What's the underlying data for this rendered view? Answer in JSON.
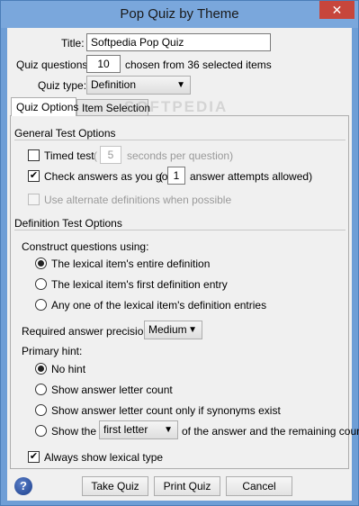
{
  "window": {
    "title": "Pop Quiz by Theme",
    "close_glyph": "✕"
  },
  "header": {
    "title_label": "Title:",
    "title_value": "Softpedia Pop Quiz",
    "questions_label": "Quiz questions:",
    "questions_value": "10",
    "questions_suffix": "chosen from 36 selected items",
    "type_label": "Quiz type:",
    "type_value": "Definition"
  },
  "tabs": [
    {
      "label": "Quiz Options",
      "active": true
    },
    {
      "label": "Item Selection",
      "active": false
    }
  ],
  "general": {
    "heading": "General Test Options",
    "timed_label": "Timed test",
    "timed_paren_open": "(",
    "timed_value": "5",
    "timed_suffix": "seconds per question)",
    "check_label": "Check answers as you go",
    "check_paren_open": "(",
    "check_value": "1",
    "check_suffix": "answer attempts allowed)",
    "alternate_label": "Use alternate definitions when possible",
    "check_mark": "✔"
  },
  "definition": {
    "heading": "Definition Test Options",
    "construct_label": "Construct questions using:",
    "construct_options": [
      "The lexical item's entire definition",
      "The lexical item's first definition entry",
      "Any one of the lexical item's definition entries"
    ],
    "precision_label": "Required answer precision:",
    "precision_value": "Medium",
    "hint_label": "Primary hint:",
    "hint_options": [
      "No hint",
      "Show answer letter count",
      "Show answer letter count only if synonyms exist"
    ],
    "show_prefix": "Show the",
    "show_select_value": "first letter",
    "show_suffix": "of the answer and the remaining count",
    "lexical_label": "Always show lexical type"
  },
  "footer": {
    "help_glyph": "?",
    "take_label": "Take Quiz",
    "print_label": "Print Quiz",
    "cancel_label": "Cancel"
  },
  "watermark": "SOFTPEDIA",
  "colors": {
    "titlebar": "#7aa7dc",
    "close": "#c7463c",
    "client": "#f0f0f0"
  }
}
